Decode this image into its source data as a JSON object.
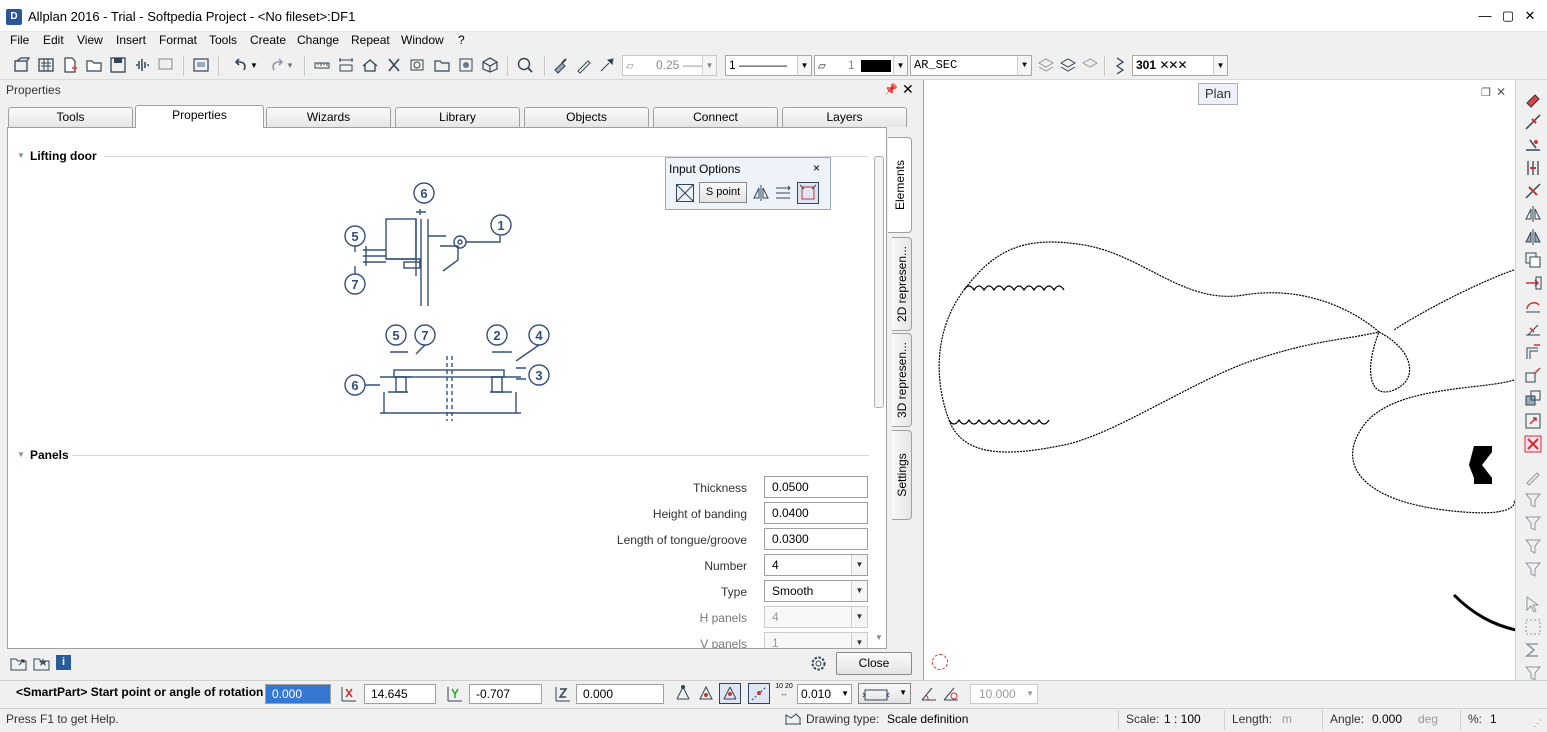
{
  "window": {
    "title": "Allplan 2016 - Trial - Softpedia Project - <No fileset>:DF1",
    "app_icon_letter": "D"
  },
  "menu": [
    "File",
    "Edit",
    "View",
    "Insert",
    "Format",
    "Tools",
    "Create",
    "Change",
    "Repeat",
    "Window",
    "?"
  ],
  "toolbar": {
    "pen_thickness": "0.25",
    "line_type": "1",
    "color_number": "1",
    "layer": "AR_SEC",
    "hatch_number": "301"
  },
  "properties_panel": {
    "header": "Properties",
    "tabs": [
      "Tools",
      "Properties",
      "Wizards",
      "Library",
      "Objects",
      "Connect",
      "Layers"
    ],
    "active_tab": "Properties",
    "side_tabs": [
      "Elements",
      "2D represen...",
      "3D represen...",
      "Settings"
    ],
    "sections": {
      "lifting_door": "Lifting door",
      "panels": "Panels"
    },
    "diagram_callouts": {
      "top": [
        "6",
        "1",
        "5",
        "7"
      ],
      "bottom": [
        "5",
        "7",
        "2",
        "4",
        "6",
        "3"
      ]
    },
    "fields": [
      {
        "label": "Thickness",
        "value": "0.0500"
      },
      {
        "label": "Height of banding",
        "value": "0.0400"
      },
      {
        "label": "Length of tongue/groove",
        "value": "0.0300"
      },
      {
        "label": "Number",
        "value": "4"
      },
      {
        "label": "Type",
        "value": "Smooth"
      },
      {
        "label": "H panels",
        "value": "4"
      },
      {
        "label": "V panels",
        "value": "1"
      }
    ],
    "close_label": "Close"
  },
  "input_options": {
    "title": "Input Options",
    "close": "×",
    "s_point_label": "S point"
  },
  "viewport": {
    "tooltip": "Plan"
  },
  "command_bar": {
    "prompt": "<SmartPart> Start point or angle of rotation",
    "angle_value": "0.000",
    "x_value": "14.645",
    "y_value": "-0.707",
    "z_value": "0.000",
    "step_value": "0.010",
    "grid_value": "10.000"
  },
  "status_bar": {
    "help": "Press F1 to get Help.",
    "drawing_type_label": "Drawing type:",
    "drawing_type_value": "Scale definition",
    "scale_label": "Scale:",
    "scale_value": "1 : 100",
    "length_label": "Length:",
    "length_unit": "m",
    "angle_label": "Angle:",
    "angle_value": "0.000",
    "angle_unit": "deg",
    "percent_label": "%:",
    "percent_value": "1"
  }
}
